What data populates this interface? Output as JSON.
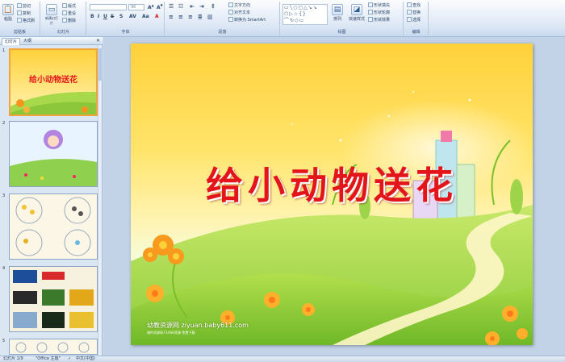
{
  "ribbon": {
    "groups": {
      "clipboard": {
        "label": "剪贴板",
        "paste": "粘贴",
        "cut": "剪切",
        "copy": "复制",
        "format_painter": "格式刷"
      },
      "slides": {
        "label": "幻灯片",
        "new_slide": "新建幻灯片",
        "layout": "版式",
        "reset": "重设",
        "delete": "删除"
      },
      "font": {
        "label": "字体",
        "font_name": "",
        "font_size": "96"
      },
      "paragraph": {
        "label": "段落",
        "text_direction": "文字方向",
        "align_text": "对齐文本",
        "smartart": "转换为 SmartArt"
      },
      "drawing": {
        "label": "绘图",
        "arrange": "排列",
        "quick_styles": "快速样式",
        "shape_fill": "形状填充",
        "shape_outline": "形状轮廓",
        "shape_effects": "形状效果"
      },
      "editing": {
        "label": "编辑",
        "find": "查找",
        "replace": "替换",
        "select": "选择"
      }
    }
  },
  "panel": {
    "tabs": [
      "幻灯片",
      "大纲"
    ],
    "slides": [
      {
        "num": "1",
        "title": "给小动物送花"
      },
      {
        "num": "2"
      },
      {
        "num": "3"
      },
      {
        "num": "4"
      },
      {
        "num": "5"
      }
    ]
  },
  "slide": {
    "title": "给小动物送花",
    "watermark": "幼教资源网 ziyuan.baby611.com",
    "watermark_sub": "课件资源网 FLASH资源 免费下载"
  },
  "status": {
    "slide_count": "幻灯片 1/9",
    "theme": "\"Office 主题\"",
    "language": "中文(中国)"
  },
  "colors": {
    "title_red": "#e4141b",
    "accent_orange": "#f2a33a"
  }
}
